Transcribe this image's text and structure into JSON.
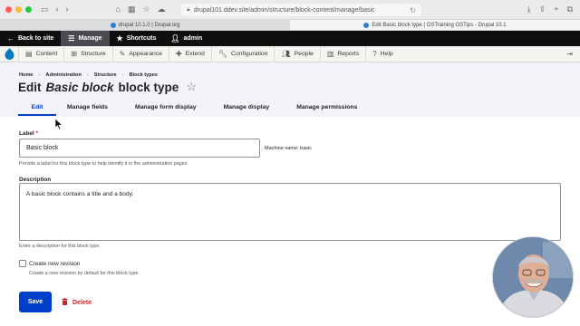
{
  "browser": {
    "url": "drupal101.ddev.site/admin/structure/block-content/manage/basic",
    "tabs": [
      {
        "label": "drupal 10.1.0 | Drupal.org",
        "active": false
      },
      {
        "label": "Edit Basic block type | OSTraining OSTips - Drupal 10.1",
        "active": true
      }
    ]
  },
  "toolbar": {
    "back_to_site": "Back to site",
    "manage": "Manage",
    "shortcuts": "Shortcuts",
    "user": "admin"
  },
  "admin_menu": {
    "items": [
      "Content",
      "Structure",
      "Appearance",
      "Extend",
      "Configuration",
      "People",
      "Reports",
      "Help"
    ]
  },
  "breadcrumb": [
    "Home",
    "Administration",
    "Structure",
    "Block types"
  ],
  "page_title": {
    "prefix": "Edit",
    "emphasis": "Basic block",
    "suffix": "block type"
  },
  "tabs": [
    "Edit",
    "Manage fields",
    "Manage form display",
    "Manage display",
    "Manage permissions"
  ],
  "form": {
    "label_title": "Label",
    "label_required": "*",
    "label_value": "Basic block",
    "machine_name": "Machine name: basic",
    "label_help": "Provide a label for this block type to help identify it in the administration pages.",
    "description_title": "Description",
    "description_value": "A basic block contains a title and a body.",
    "description_help": "Enter a description for this block type.",
    "revision_label": "Create new revision",
    "revision_help": "Create a new revision by default for this block type.",
    "revision_checked": false,
    "save": "Save",
    "delete": "Delete"
  },
  "colors": {
    "primary": "#003ecc",
    "danger": "#d72222",
    "toolbar": "#0f0f0f"
  }
}
